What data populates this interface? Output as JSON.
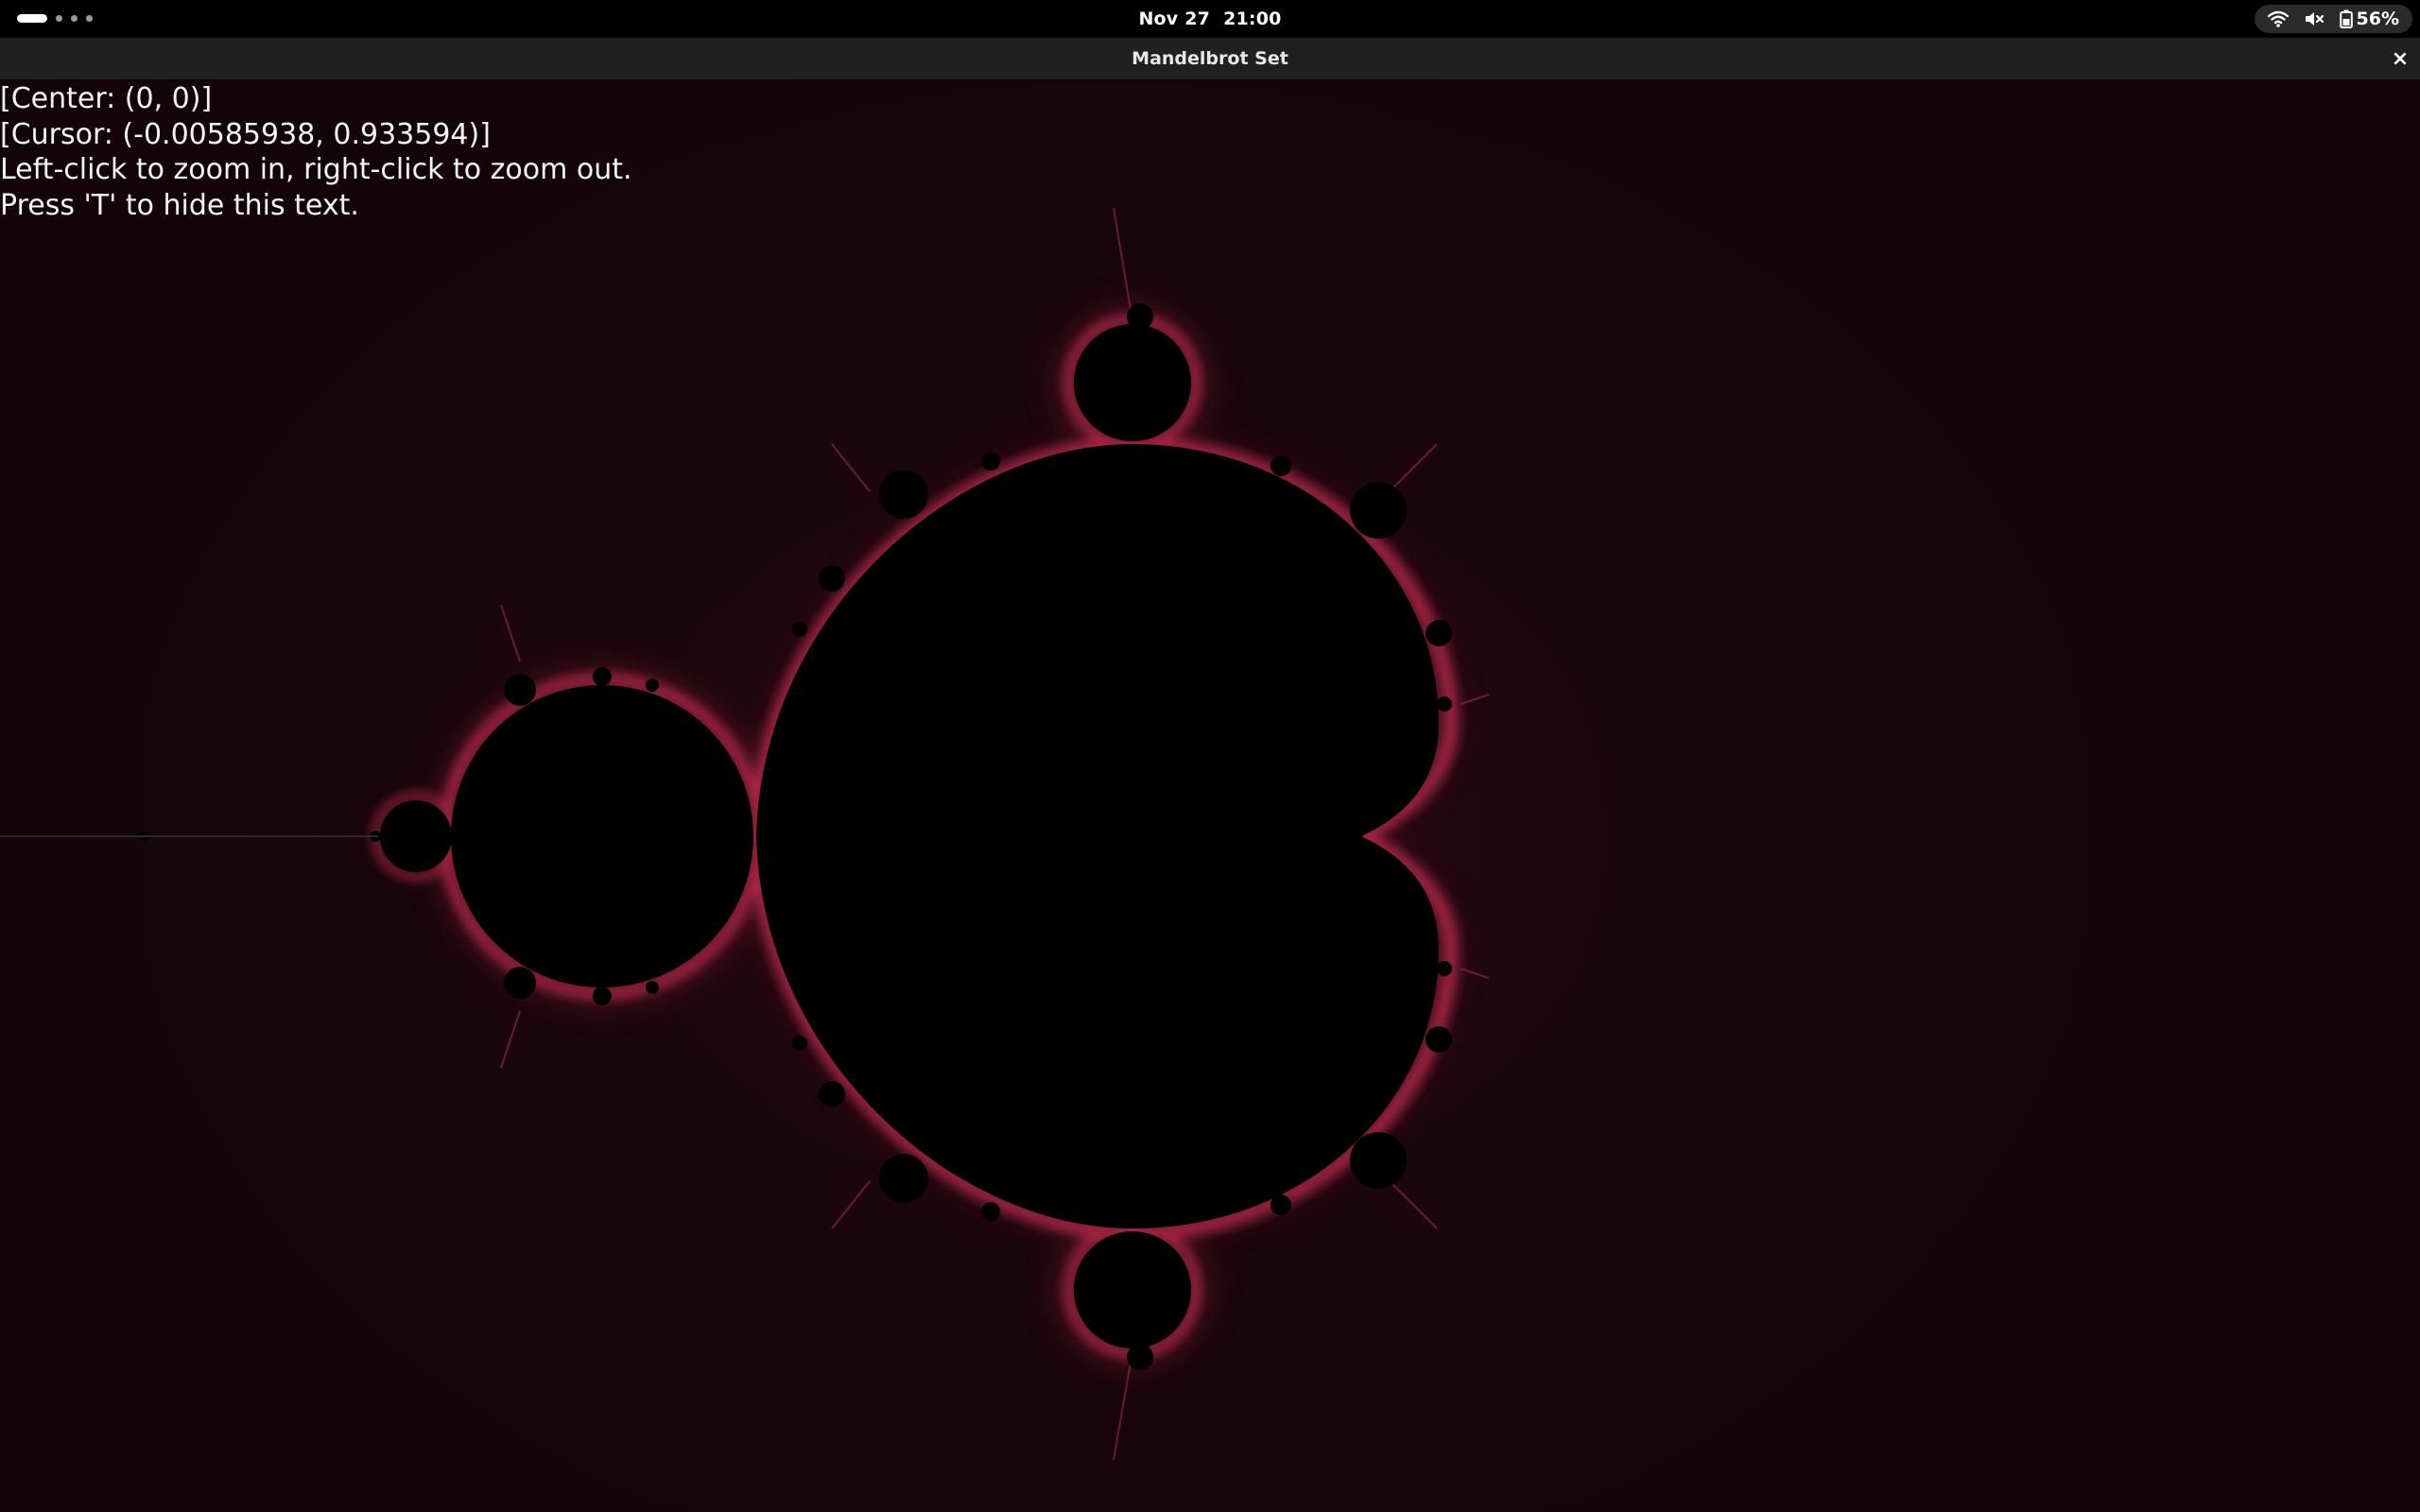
{
  "system_bar": {
    "date": "Nov 27",
    "time": "21:00",
    "battery_percent": "56%",
    "icons": [
      "wifi-icon",
      "volume-muted-icon",
      "battery-icon"
    ]
  },
  "window": {
    "title": "Mandelbrot Set",
    "close_symbol": "×"
  },
  "overlay": {
    "center": "[Center: (0, 0)]",
    "cursor": "[Cursor: (-0.00585938, 0.933594)]",
    "instructions_zoom": "Left-click to zoom in, right-click to zoom out.",
    "instructions_hide": "Press 'T' to hide this text."
  },
  "colors": {
    "background": "#120409",
    "set": "#000000",
    "glow": "#c0304f",
    "titlebar": "#202020"
  }
}
